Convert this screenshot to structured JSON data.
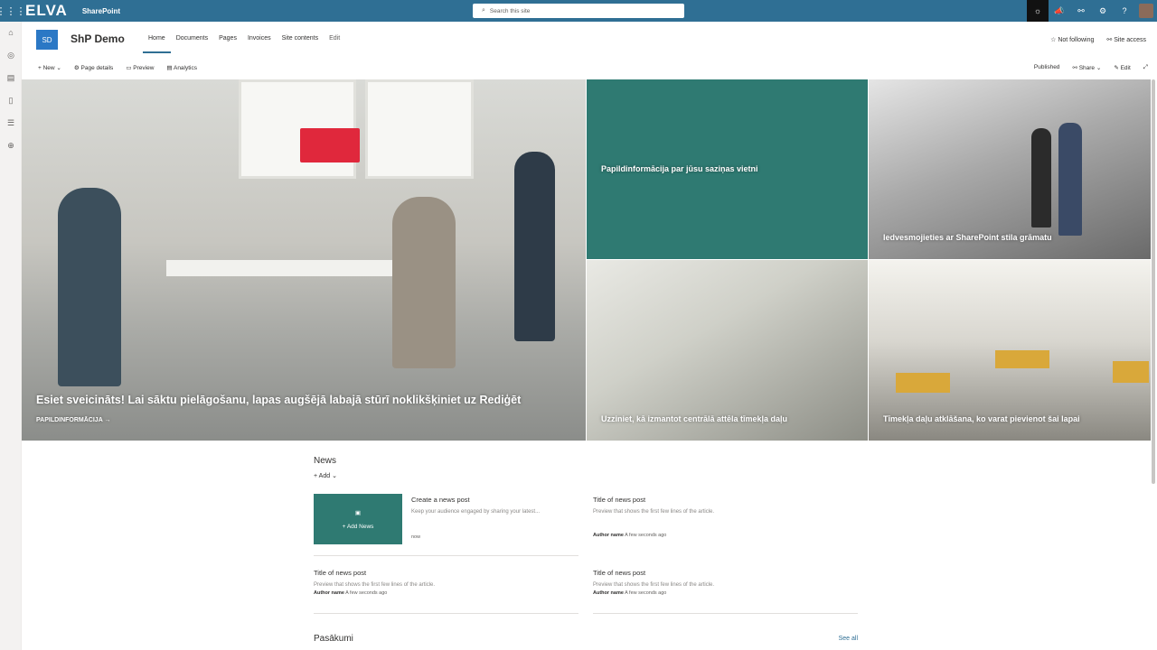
{
  "suitebar": {
    "logo": "ELVA",
    "app": "SharePoint",
    "search_placeholder": "Search this site",
    "icons": [
      "waffle-icon",
      "lightbulb-icon",
      "megaphone-icon",
      "share-icon",
      "gear-icon",
      "help-icon",
      "avatar"
    ]
  },
  "site": {
    "initials": "SD",
    "title": "ShP Demo",
    "nav": [
      "Home",
      "Documents",
      "Pages",
      "Invoices",
      "Site contents",
      "Edit"
    ],
    "follow": "Not following",
    "access": "Site access"
  },
  "commands": {
    "left": [
      "New",
      "Page details",
      "Preview",
      "Analytics"
    ],
    "right": [
      "Published",
      "Share",
      "Edit"
    ]
  },
  "hero": {
    "main": {
      "title": "Esiet sveicināts! Lai sāktu pielāgošanu, lapas augšējā labajā stūrī noklikšķiniet uz Rediģēt",
      "link": "PAPILDINFORMĀCIJA"
    },
    "tile2": "Papildinformācija par jūsu saziņas vietni",
    "tile3": "Iedvesmojieties ar SharePoint stila grāmatu",
    "tile4": "Uzziniet, kā izmantot centrālā attēla tīmekļa daļu",
    "tile5": "Tīmekļa daļu atklāšana, ko varat pievienot šai lapai"
  },
  "news": {
    "title": "News",
    "add": "Add",
    "addnews": "Add News",
    "items": [
      {
        "title": "Create a news post",
        "preview": "Keep your audience engaged by sharing your latest...",
        "author": "",
        "time": "now"
      },
      {
        "title": "Title of news post",
        "preview": "Preview that shows the first few lines of the article.",
        "author": "Author name",
        "time": "A few seconds ago"
      },
      {
        "title": "Title of news post",
        "preview": "Preview that shows the first few lines of the article.",
        "author": "Author name",
        "time": "A few seconds ago"
      },
      {
        "title": "Title of news post",
        "preview": "Preview that shows the first few lines of the article.",
        "author": "Author name",
        "time": "A few seconds ago"
      }
    ]
  },
  "events": {
    "title": "Pasākumi",
    "seeall": "See all"
  }
}
